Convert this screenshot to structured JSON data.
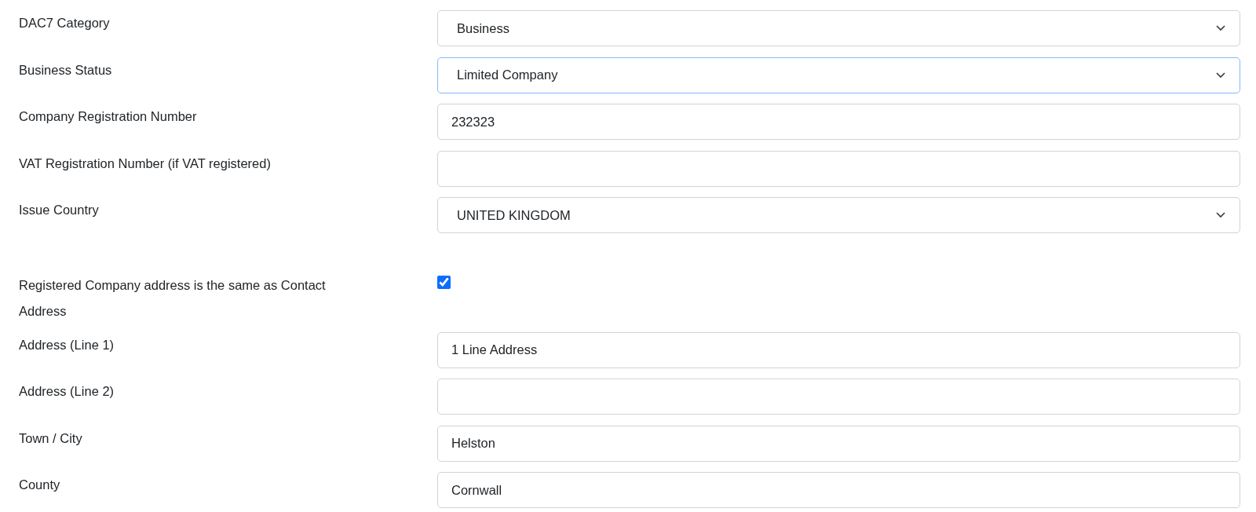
{
  "fields": [
    {
      "kind": "select",
      "label": "DAC7 Category",
      "value": "Business",
      "focused": false
    },
    {
      "kind": "select",
      "label": "Business Status",
      "value": "Limited Company",
      "focused": true
    },
    {
      "kind": "text",
      "label": "Company Registration Number",
      "value": "232323",
      "focused": false
    },
    {
      "kind": "text",
      "label": "VAT Registration Number (if VAT registered)",
      "focused": false
    },
    {
      "kind": "select",
      "label": "Issue Country",
      "value": "UNITED KINGDOM",
      "focused": false
    },
    {
      "kind": "checkbox",
      "label": "Registered Company address is the same as Contact Address",
      "checked": true
    },
    {
      "kind": "text",
      "label": "Address (Line 1)",
      "value": "1 Line Address",
      "focused": false
    },
    {
      "kind": "text",
      "label": "Address (Line 2)",
      "focused": false
    },
    {
      "kind": "text",
      "label": "Town / City",
      "value": "Helston",
      "focused": false
    },
    {
      "kind": "text",
      "label": "County",
      "value": "Cornwall",
      "focused": false
    }
  ]
}
